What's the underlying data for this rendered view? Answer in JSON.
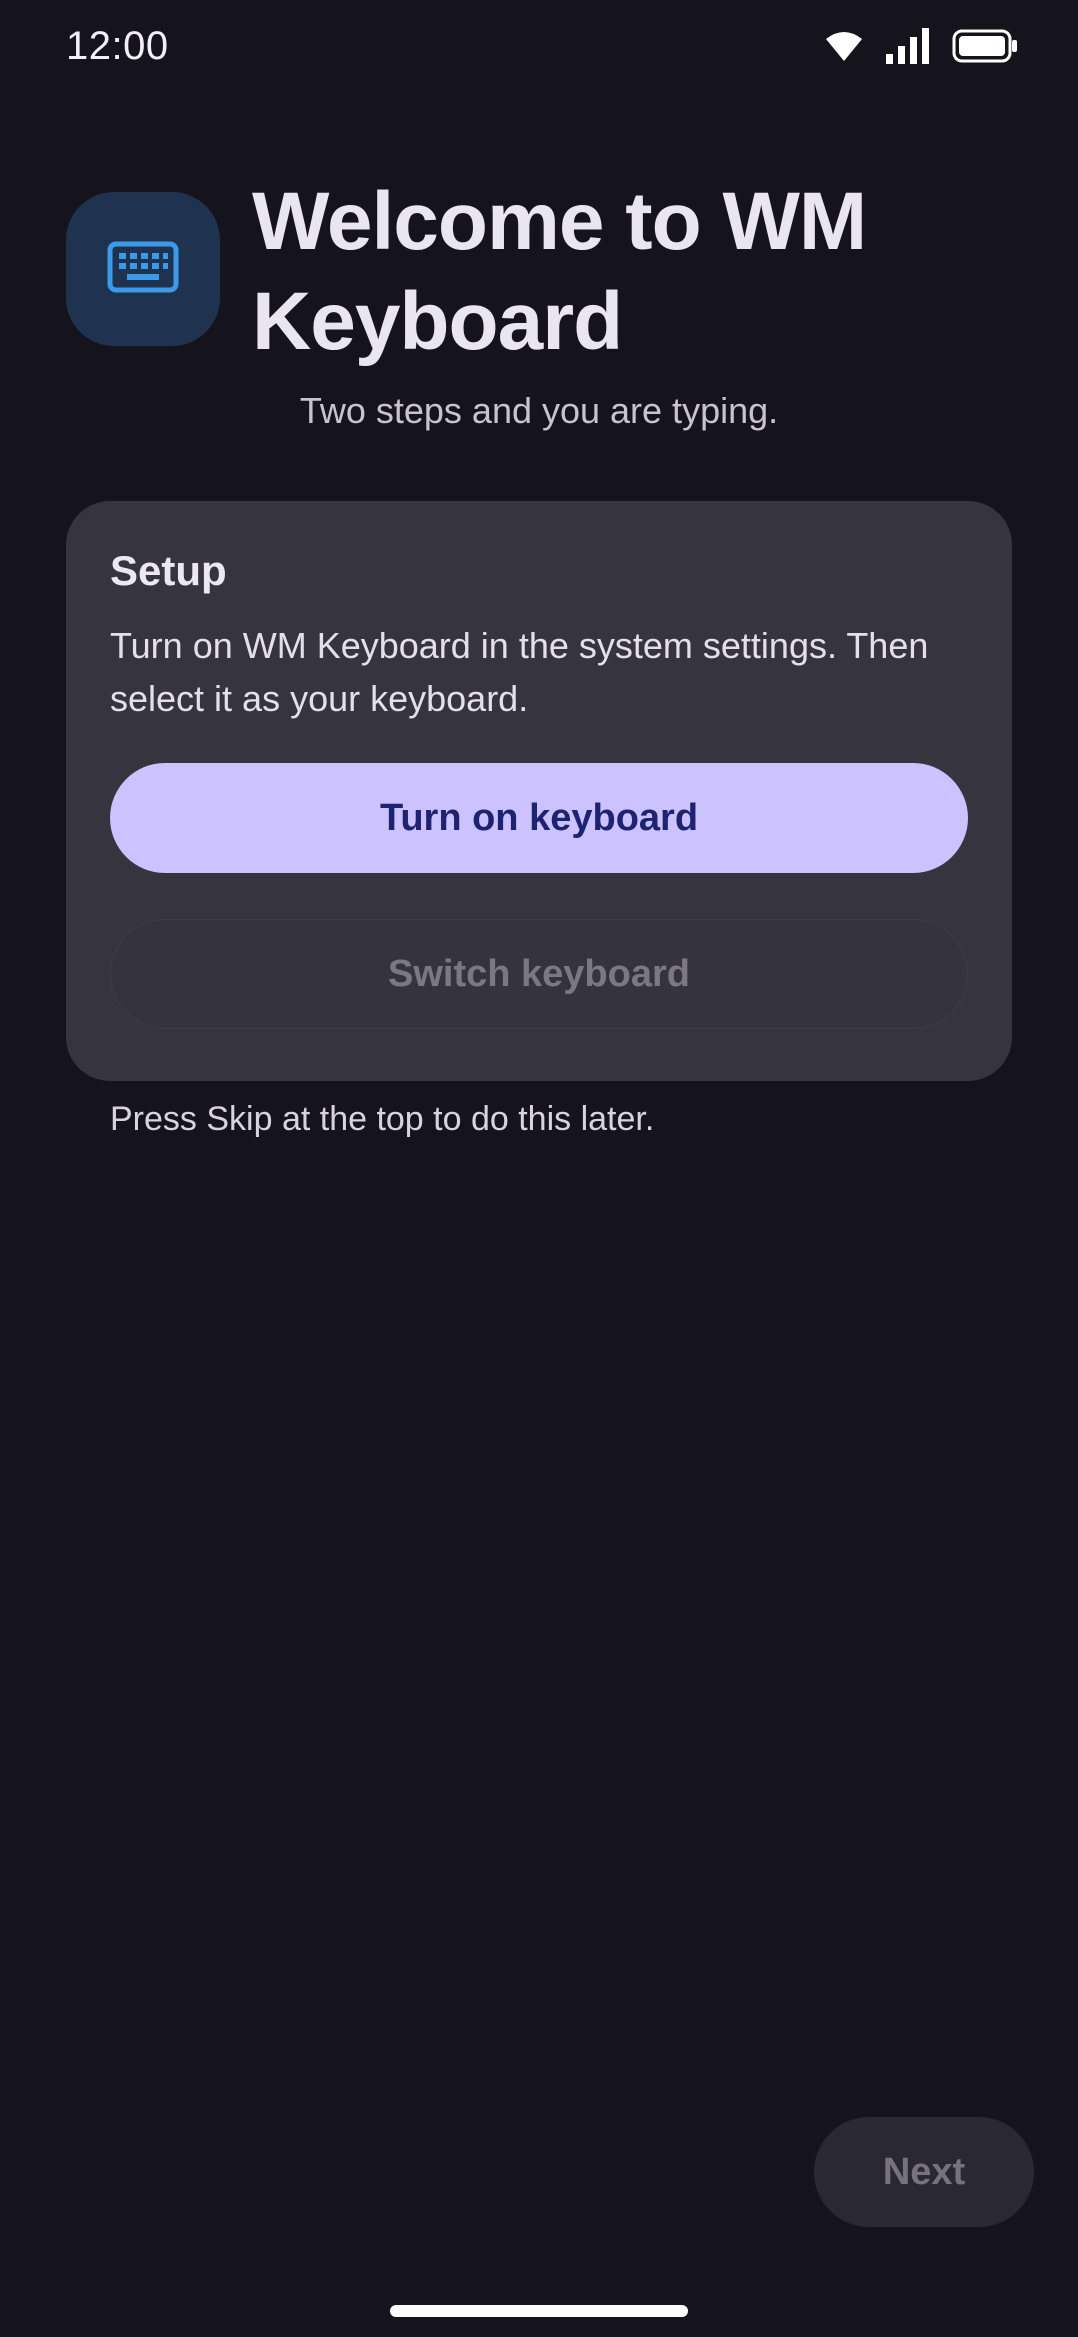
{
  "status_bar": {
    "time": "12:00",
    "icons": [
      "wifi-icon",
      "signal-icon",
      "battery-icon"
    ]
  },
  "header": {
    "app_icon": "keyboard-icon",
    "title": "Welcome to WM Keyboard",
    "subtitle": "Two steps and you are typing."
  },
  "setup_card": {
    "title": "Setup",
    "description": "Turn on WM Keyboard in the system settings. Then select it as your keyboard.",
    "primary_button_label": "Turn on keyboard",
    "secondary_button_label": "Switch keyboard",
    "secondary_button_enabled": false
  },
  "skip_hint": "Press Skip at the top to do this later.",
  "footer": {
    "next_label": "Next",
    "next_enabled": false
  },
  "colors": {
    "background": "#15141c",
    "card": "#36353f",
    "primary": "#cbc2ff",
    "primary_text": "#1d2370",
    "app_icon_bg": "#1f3350",
    "app_icon_fg": "#3b9be8"
  }
}
